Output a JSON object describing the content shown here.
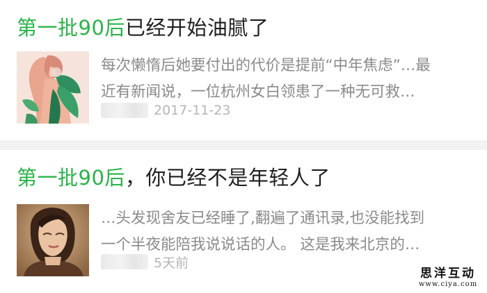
{
  "articles": [
    {
      "title_highlight": "第一批90后",
      "title_rest": "已经开始油腻了",
      "snippet_line1": "每次懒惰后她要付出的代价是提前“中年焦虑”…最",
      "snippet_line2": "近有新闻说，一位杭州女白领患了一种无可救…",
      "date": "2017-11-23"
    },
    {
      "title_highlight": "第一批90后",
      "title_rest": "，你已经不是年轻人了",
      "snippet_line1": "…头发现舍友已经睡了,翻遍了通讯录,也没能找到",
      "snippet_line2": "一个半夜能陪我说说话的人。 这是我来北京的…",
      "date": "5天前"
    }
  ],
  "watermark": {
    "main": "思洋互动",
    "url": "www.ciya.com"
  },
  "colors": {
    "highlight": "#2bb34a",
    "title": "#1f1f1f",
    "snippet": "#8a8a8a",
    "date": "#b5b5b5",
    "background": "#f2f2f2"
  }
}
